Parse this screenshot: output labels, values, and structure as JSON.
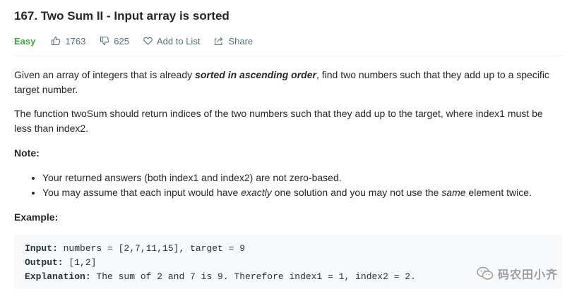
{
  "problem": {
    "title": "167. Two Sum II - Input array is sorted",
    "difficulty": "Easy",
    "likes": "1763",
    "dislikes": "625",
    "add_to_list": "Add to List",
    "share": "Share"
  },
  "description": {
    "p1_before": "Given an array of integers that is already ",
    "p1_emphasis": "sorted in ascending order",
    "p1_after": ", find two numbers such that they add up to a specific target number.",
    "p2": "The function twoSum should return indices of the two numbers such that they add up to the target, where index1 must be less than index2.",
    "note_heading": "Note:",
    "note1": "Your returned answers (both index1 and index2) are not zero-based.",
    "note2_a": "You may assume that each input would have ",
    "note2_em1": "exactly",
    "note2_b": " one solution and you may not use the ",
    "note2_em2": "same",
    "note2_c": " element twice.",
    "example_heading": "Example:"
  },
  "example": {
    "input_label": "Input:",
    "input_value": " numbers = [2,7,11,15], target = 9",
    "output_label": "Output:",
    "output_value": " [1,2]",
    "explanation_label": "Explanation:",
    "explanation_value": " The sum of 2 and 7 is 9. Therefore index1 = 1, index2 = 2."
  },
  "watermark": {
    "text": "码农田小齐"
  },
  "colors": {
    "easy": "#43a047",
    "meta": "#546e7a",
    "code_bg": "#f7f9fa"
  }
}
